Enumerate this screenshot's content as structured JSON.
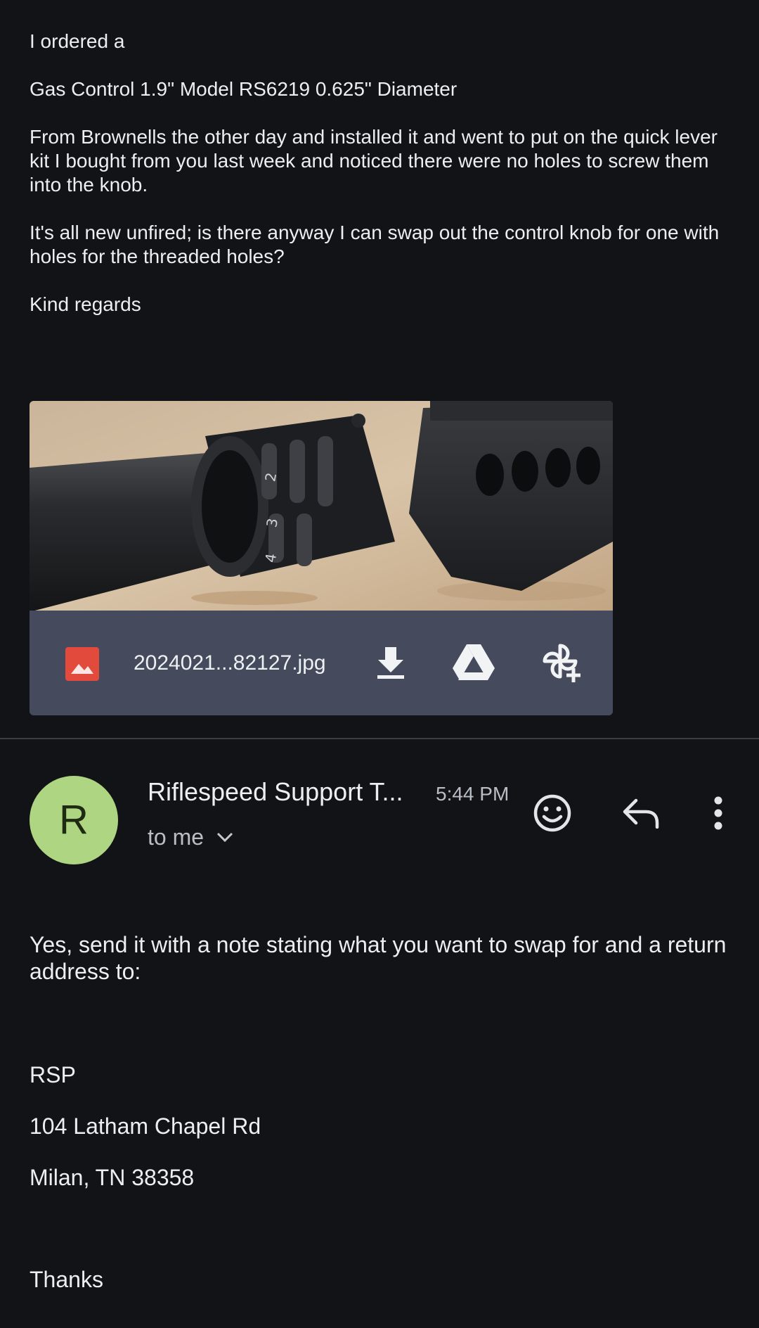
{
  "message1": {
    "paragraphs": [
      "I ordered a",
      "Gas Control 1.9\" Model RS6219 0.625\" Diameter",
      "From Brownells the other day and installed it and went to put on the quick lever kit I bought from you last week and noticed there were no holes to screw them into the knob.",
      "It's all new unfired; is there anyway I can swap out the control knob for one with holes for the threaded holes?",
      "Kind regards"
    ],
    "attachment": {
      "filename": "2024021...82127.jpg",
      "icon": "image-file-icon",
      "actions": [
        "download-icon",
        "drive-icon",
        "add-to-photos-icon"
      ]
    }
  },
  "message2": {
    "avatar_letter": "R",
    "avatar_color": "#aed581",
    "sender": "Riflespeed Support T...",
    "time": "5:44 PM",
    "recipient": "to me",
    "header_actions": [
      "emoji-icon",
      "reply-icon",
      "more-vert-icon"
    ],
    "paragraphs": [
      "Yes, send it with a note stating what you want to swap for and a return address to:",
      "RSP",
      "104 Latham Chapel Rd",
      "Milan, TN 38358",
      "Thanks"
    ]
  }
}
